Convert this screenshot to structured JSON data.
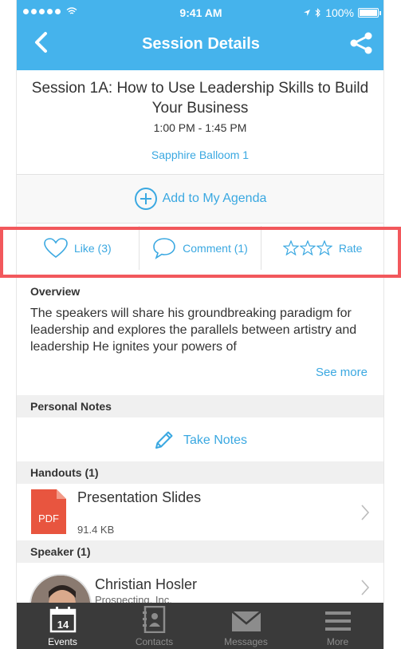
{
  "status_bar": {
    "time": "9:41 AM",
    "battery": "100%"
  },
  "nav": {
    "title": "Session Details",
    "back_icon": "chevron-left-icon",
    "share_icon": "share-icon"
  },
  "session": {
    "title": "Session 1A: How to Use Leadership Skills to Build Your Business",
    "time": "1:00 PM - 1:45 PM",
    "room": "Sapphire Balloom 1"
  },
  "agenda": {
    "label": "Add to My Agenda",
    "icon": "plus-circle-icon"
  },
  "actions": {
    "like": {
      "label": "Like (3)",
      "icon": "heart-icon"
    },
    "comment": {
      "label": "Comment (1)",
      "icon": "speech-bubble-icon"
    },
    "rate": {
      "label": "Rate",
      "icon": "star-icon",
      "stars": 3,
      "filled": 0
    }
  },
  "overview": {
    "label": "Overview",
    "text": "The speakers will share his groundbreaking paradigm for leadership and explores the parallels between artistry and leadership He ignites your powers of",
    "see_more": "See more"
  },
  "personal_notes": {
    "label": "Personal Notes",
    "action": "Take Notes",
    "icon": "pencil-icon"
  },
  "handouts": {
    "label": "Handouts  (1)",
    "items": [
      {
        "name": "Presentation Slides",
        "size": "91.4 KB",
        "type": "PDF"
      }
    ]
  },
  "speakers": {
    "label": "Speaker  (1)",
    "items": [
      {
        "name": "Christian Hosler",
        "company": "Prospecting, Inc."
      }
    ]
  },
  "tabbar": {
    "tabs": [
      {
        "label": "Events",
        "icon": "calendar-icon",
        "badge": "14",
        "active": true
      },
      {
        "label": "Contacts",
        "icon": "address-book-icon",
        "active": false
      },
      {
        "label": "Messages",
        "icon": "envelope-icon",
        "active": false
      },
      {
        "label": "More",
        "icon": "menu-icon",
        "active": false
      }
    ]
  },
  "colors": {
    "accent": "#45b3ec",
    "link": "#3aa8e1",
    "highlight": "#f2585c",
    "tabbar": "#3a3a3a",
    "pdf": "#e8553f"
  }
}
